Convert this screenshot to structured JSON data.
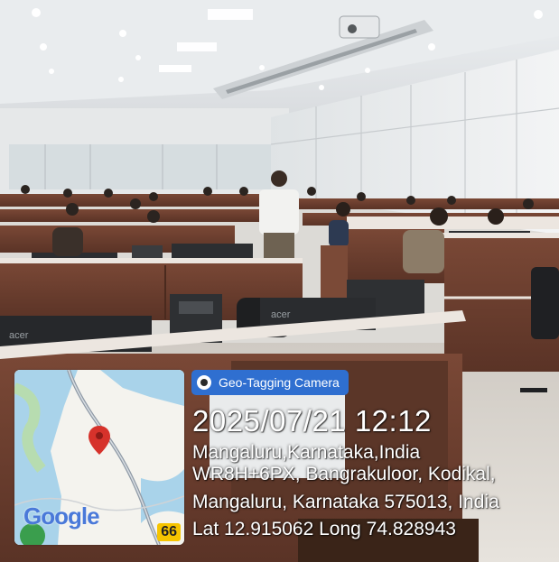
{
  "photo": {
    "subject": "classroom-computer-lab",
    "monitor_brand": "acer"
  },
  "map": {
    "logo": "Google",
    "route_number": "66",
    "icons": [
      "map-pin-icon",
      "google-logo"
    ]
  },
  "geotag": {
    "app_name": "Geo-Tagging Camera",
    "datetime": "2025/07/21 12:12",
    "line1": "Mangaluru,Karnataka,India",
    "line2": "WR8H+6PX, Bangrakuloor, Kodikal,",
    "line3": "Mangaluru, Karnataka 575013, India",
    "line4": "Lat 12.915062 Long 74.828943"
  },
  "colors": {
    "badge": "#2f6fd0",
    "desk_wood": "#6b3f2f",
    "route_badge": "#f6c400",
    "pin": "#d6322b"
  }
}
